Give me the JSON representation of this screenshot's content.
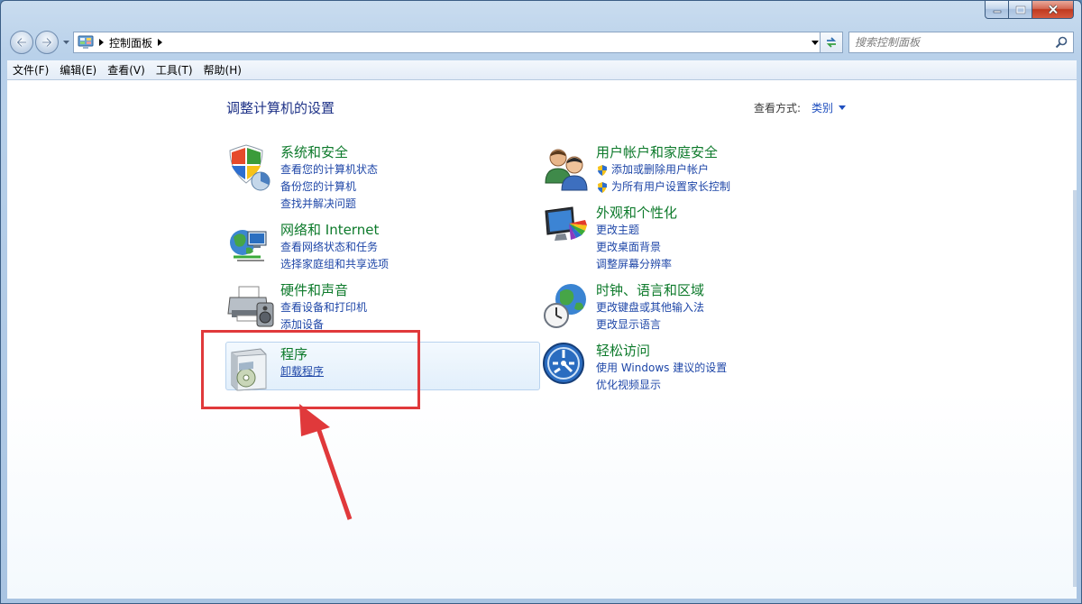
{
  "window": {
    "caption": {
      "minimize": "minimize",
      "maximize": "maximize",
      "close": "close"
    }
  },
  "navigation": {
    "breadcrumb": [
      "控制面板"
    ],
    "search_placeholder": "搜索控制面板"
  },
  "menu": [
    "文件(F)",
    "编辑(E)",
    "查看(V)",
    "工具(T)",
    "帮助(H)"
  ],
  "content": {
    "title": "调整计算机的设置",
    "view_by_label": "查看方式:",
    "view_by_value": "类别",
    "categories": [
      {
        "icon": "security-shield-icon",
        "title": "系统和安全",
        "links": [
          "查看您的计算机状态",
          "备份您的计算机",
          "查找并解决问题"
        ]
      },
      {
        "icon": "network-globe-icon",
        "title": "网络和 Internet",
        "links": [
          "查看网络状态和任务",
          "选择家庭组和共享选项"
        ]
      },
      {
        "icon": "printer-icon",
        "title": "硬件和声音",
        "links": [
          "查看设备和打印机",
          "添加设备"
        ]
      },
      {
        "icon": "programs-box-icon",
        "title": "程序",
        "links": [
          "卸载程序"
        ]
      },
      {
        "icon": "users-icon",
        "title": "用户帐户和家庭安全",
        "links": [
          "添加或删除用户帐户",
          "为所有用户设置家长控制"
        ]
      },
      {
        "icon": "appearance-monitor-icon",
        "title": "外观和个性化",
        "links": [
          "更改主题",
          "更改桌面背景",
          "调整屏幕分辨率"
        ]
      },
      {
        "icon": "clock-globe-icon",
        "title": "时钟、语言和区域",
        "links": [
          "更改键盘或其他输入法",
          "更改显示语言"
        ]
      },
      {
        "icon": "ease-of-access-icon",
        "title": "轻松访问",
        "links": [
          "使用 Windows 建议的设置",
          "优化视频显示"
        ]
      }
    ]
  },
  "colors": {
    "title": "#1e3287",
    "category_title": "#0d7a2b",
    "link": "#1f47a8",
    "annotation": "#e0393b"
  }
}
